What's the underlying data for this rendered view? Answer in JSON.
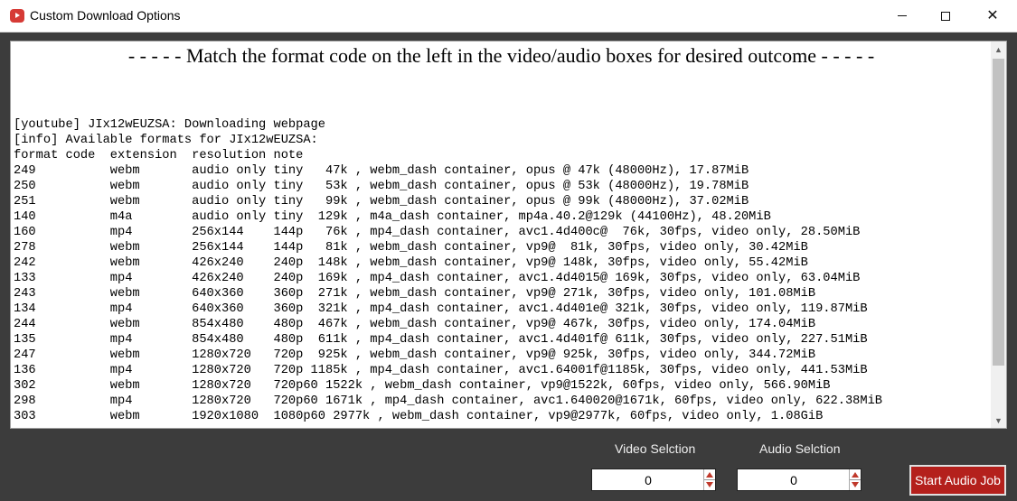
{
  "window": {
    "title": "Custom Download Options",
    "controls": {
      "minimize_icon": "minimize-icon",
      "maximize_icon": "maximize-icon",
      "close_icon": "close-icon",
      "close_glyph": "✕"
    }
  },
  "output": {
    "header": "- - - - - Match the format code on the left in the video/audio boxes for desired outcome - - - - -",
    "lines": [
      "[youtube] JIx12wEUZSA: Downloading webpage",
      "[info] Available formats for JIx12wEUZSA:",
      "format code  extension  resolution note",
      "249          webm       audio only tiny   47k , webm_dash container, opus @ 47k (48000Hz), 17.87MiB",
      "250          webm       audio only tiny   53k , webm_dash container, opus @ 53k (48000Hz), 19.78MiB",
      "251          webm       audio only tiny   99k , webm_dash container, opus @ 99k (48000Hz), 37.02MiB",
      "140          m4a        audio only tiny  129k , m4a_dash container, mp4a.40.2@129k (44100Hz), 48.20MiB",
      "160          mp4        256x144    144p   76k , mp4_dash container, avc1.4d400c@  76k, 30fps, video only, 28.50MiB",
      "278          webm       256x144    144p   81k , webm_dash container, vp9@  81k, 30fps, video only, 30.42MiB",
      "242          webm       426x240    240p  148k , webm_dash container, vp9@ 148k, 30fps, video only, 55.42MiB",
      "133          mp4        426x240    240p  169k , mp4_dash container, avc1.4d4015@ 169k, 30fps, video only, 63.04MiB",
      "243          webm       640x360    360p  271k , webm_dash container, vp9@ 271k, 30fps, video only, 101.08MiB",
      "134          mp4        640x360    360p  321k , mp4_dash container, avc1.4d401e@ 321k, 30fps, video only, 119.87MiB",
      "244          webm       854x480    480p  467k , webm_dash container, vp9@ 467k, 30fps, video only, 174.04MiB",
      "135          mp4        854x480    480p  611k , mp4_dash container, avc1.4d401f@ 611k, 30fps, video only, 227.51MiB",
      "247          webm       1280x720   720p  925k , webm_dash container, vp9@ 925k, 30fps, video only, 344.72MiB",
      "136          mp4        1280x720   720p 1185k , mp4_dash container, avc1.64001f@1185k, 30fps, video only, 441.53MiB",
      "302          webm       1280x720   720p60 1522k , webm_dash container, vp9@1522k, 60fps, video only, 566.90MiB",
      "298          mp4        1280x720   720p60 1671k , mp4_dash container, avc1.640020@1671k, 60fps, video only, 622.38MiB",
      "303          webm       1920x1080  1080p60 2977k , webm_dash container, vp9@2977k, 60fps, video only, 1.08GiB"
    ]
  },
  "controls": {
    "video_label": "Video Selction",
    "video_value": "0",
    "audio_label": "Audio Selction",
    "audio_value": "0",
    "start_button": "Start Audio Job"
  },
  "colors": {
    "window_bg": "#3c3c3c",
    "button_bg": "#b4201c",
    "spinner_arrows": "#c0392b"
  }
}
